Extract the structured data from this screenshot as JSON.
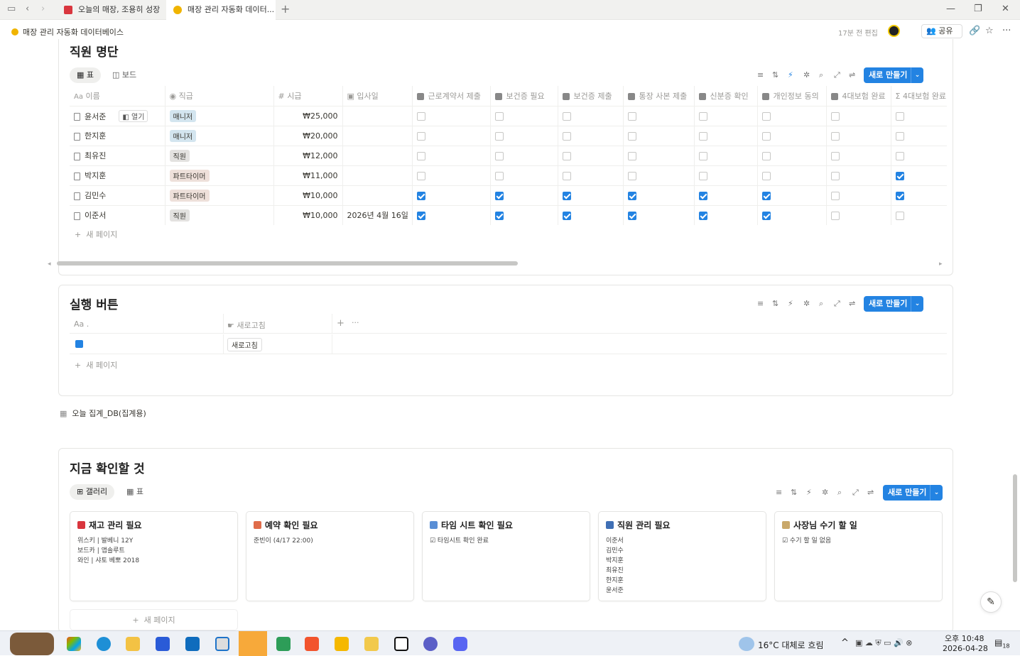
{
  "browser": {
    "tabs": [
      {
        "title": "오늘의 매장, 조용히 성장",
        "color": "#d9363e"
      },
      {
        "title": "매장 관리 자동화 데이터...",
        "color": "#f0b400"
      }
    ],
    "new_tab": "+",
    "window": {
      "min": "—",
      "max": "❐",
      "close": "✕"
    }
  },
  "topbar": {
    "breadcrumb": "매장 관리 자동화 데이터베이스",
    "edited": "17분 전 편집",
    "share": "공유"
  },
  "staff": {
    "title": "직원 명단",
    "views": [
      "표",
      "보드"
    ],
    "new_button": "새로 만들기",
    "columns": [
      "이름",
      "직급",
      "시급",
      "입사일",
      "근로계약서 제출",
      "보건증 필요",
      "보건증 제출",
      "통장 사본 제출",
      "신분증 확인",
      "개인정보 동의",
      "4대보험 완료",
      "4대보험 완료"
    ],
    "open_label": "열기",
    "rows": [
      {
        "name": "윤서준",
        "rank": "매니저",
        "rank_color": "#d3e5ef",
        "wage": "₩25,000",
        "date": "",
        "checks": [
          false,
          false,
          false,
          false,
          false,
          false,
          false,
          false
        ]
      },
      {
        "name": "한지훈",
        "rank": "매니저",
        "rank_color": "#d3e5ef",
        "wage": "₩20,000",
        "date": "",
        "checks": [
          false,
          false,
          false,
          false,
          false,
          false,
          false,
          false
        ]
      },
      {
        "name": "최유진",
        "rank": "직원",
        "rank_color": "#e3e2e0",
        "wage": "₩12,000",
        "date": "",
        "checks": [
          false,
          false,
          false,
          false,
          false,
          false,
          false,
          false
        ]
      },
      {
        "name": "박지훈",
        "rank": "파트타이머",
        "rank_color": "#eee0da",
        "wage": "₩11,000",
        "date": "",
        "checks": [
          false,
          false,
          false,
          false,
          false,
          false,
          false,
          true
        ]
      },
      {
        "name": "김민수",
        "rank": "파트타이머",
        "rank_color": "#eee0da",
        "wage": "₩10,000",
        "date": "",
        "checks": [
          true,
          true,
          true,
          true,
          true,
          true,
          false,
          true
        ]
      },
      {
        "name": "이준서",
        "rank": "직원",
        "rank_color": "#e3e2e0",
        "wage": "₩10,000",
        "date": "2026년 4월 16일",
        "checks": [
          true,
          true,
          true,
          true,
          true,
          true,
          false,
          false
        ]
      }
    ],
    "add_page": "새 페이지"
  },
  "actions": {
    "title": "실행 버튼",
    "new_button": "새로 만들기",
    "col_name": "Aa .",
    "col_refresh": "새로고침",
    "refresh_button": "새로고침",
    "add_page": "새 페이지"
  },
  "linked_db": {
    "label": "오늘 집계_DB(집계용)"
  },
  "now": {
    "title": "지금 확인할 것",
    "views": [
      "갤러리",
      "표"
    ],
    "new_button": "새로 만들기",
    "cards": [
      {
        "title": "재고 관리 필요",
        "icon_color": "#d9363e",
        "lines": [
          "위스키 | 발베니 12Y",
          "보드카 | 앱솔루트",
          "와인 | 샤토 베뽀 2018"
        ]
      },
      {
        "title": "예약 확인 필요",
        "icon_color": "#e06c4a",
        "lines": [
          "준빈이 (4/17 22:00)"
        ]
      },
      {
        "title": "타임 시트 확인 필요",
        "icon_color": "#5a8fd6",
        "lines": [
          "☑ 타임시트 확인 완료"
        ]
      },
      {
        "title": "직원 관리 필요",
        "icon_color": "#3f6fb5",
        "lines": [
          "이준서",
          "김민수",
          "박지훈",
          "최유진",
          "한지훈",
          "윤서준"
        ]
      },
      {
        "title": "사장님 수기 할 일",
        "icon_color": "#c9a86a",
        "lines": [
          "☑ 수기 할 일 없음"
        ]
      }
    ],
    "add_page": "새 페이지"
  },
  "taskbar": {
    "weather": "16°C 대체로 흐림",
    "time": "오후 10:48",
    "date": "2026-04-28",
    "notif": "18"
  }
}
